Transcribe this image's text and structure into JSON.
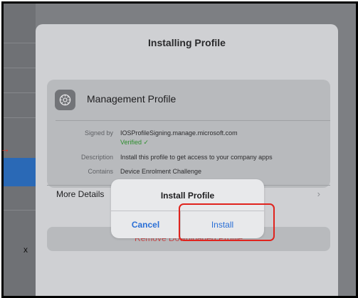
{
  "sheet": {
    "title": "Installing Profile"
  },
  "profile": {
    "name": "Management Profile",
    "icon": "gear-icon",
    "signed_by_label": "Signed by",
    "signed_by_value": "IOSProfileSigning.manage.microsoft.com",
    "verified": "Verified ✓",
    "description_label": "Description",
    "description_value": "Install this profile to get access to your company apps",
    "contains_label": "Contains",
    "contains_value": "Device Enrolment Challenge",
    "more_details": "More Details",
    "chevron": "›"
  },
  "remove": {
    "label": "Remove Downloaded Profile"
  },
  "alert": {
    "title": "Install Profile",
    "cancel": "Cancel",
    "install": "Install"
  },
  "background": {
    "x_glyph": "x"
  },
  "colors": {
    "accent": "#2a6fd6",
    "destructive": "#c8494a",
    "highlight": "#e0231d",
    "verified": "#2f8f2f"
  }
}
